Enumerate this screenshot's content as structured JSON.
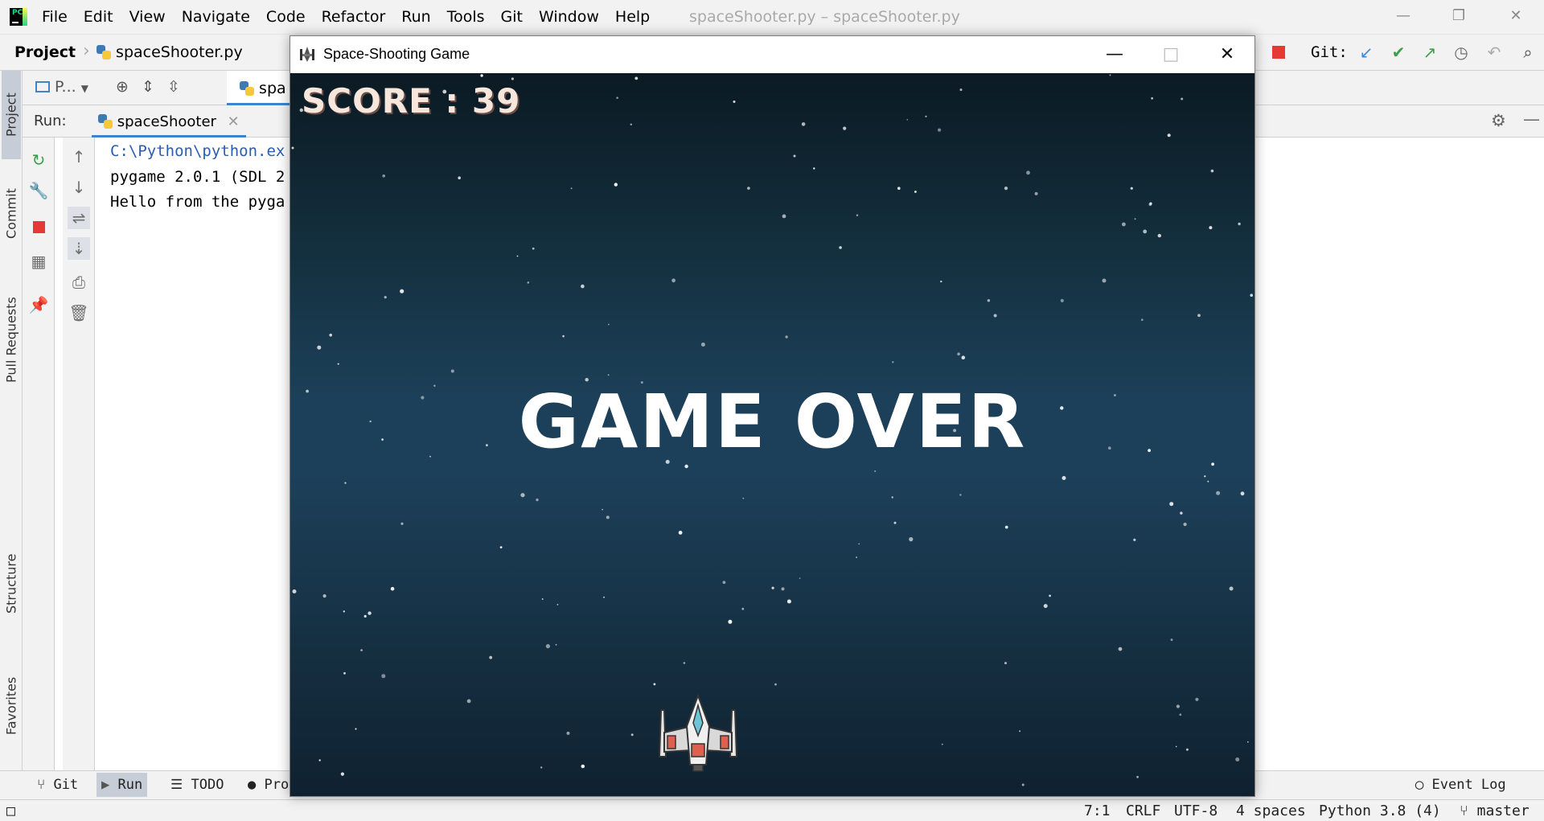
{
  "ide": {
    "menu": [
      "File",
      "Edit",
      "View",
      "Navigate",
      "Code",
      "Refactor",
      "Run",
      "Tools",
      "Git",
      "Window",
      "Help"
    ],
    "window_title": "spaceShooter.py – spaceShooter.py",
    "breadcrumb": {
      "project": "Project",
      "file": "spaceShooter.py"
    },
    "git_label": "Git:",
    "project_view_label": "P...",
    "editor_tab_label": "spa",
    "left_tabs": [
      "Project",
      "Commit",
      "Pull Requests",
      "Structure",
      "Favorites"
    ],
    "run": {
      "label": "Run:",
      "tab": "spaceShooter",
      "console": [
        "C:\\Python\\python.ex",
        "pygame 2.0.1 (SDL 2",
        "Hello from the pyga"
      ]
    },
    "bottom_tools": {
      "git": "Git",
      "run": "Run",
      "todo": "TODO",
      "problems": "Pro",
      "event_log": "Event Log"
    },
    "status": {
      "position": "7:1",
      "line_sep": "CRLF",
      "encoding": "UTF-8",
      "indent": "4 spaces",
      "interpreter": "Python 3.8 (4)",
      "branch": "master"
    }
  },
  "game": {
    "title": "Space-Shooting Game",
    "score_text": "SCORE : 39",
    "game_over_text": "GAME OVER"
  },
  "colors": {
    "accent": "#4083c9",
    "stop_red": "#e53935",
    "text_white": "#ffffff",
    "score_fill": "#f6e6dc"
  }
}
